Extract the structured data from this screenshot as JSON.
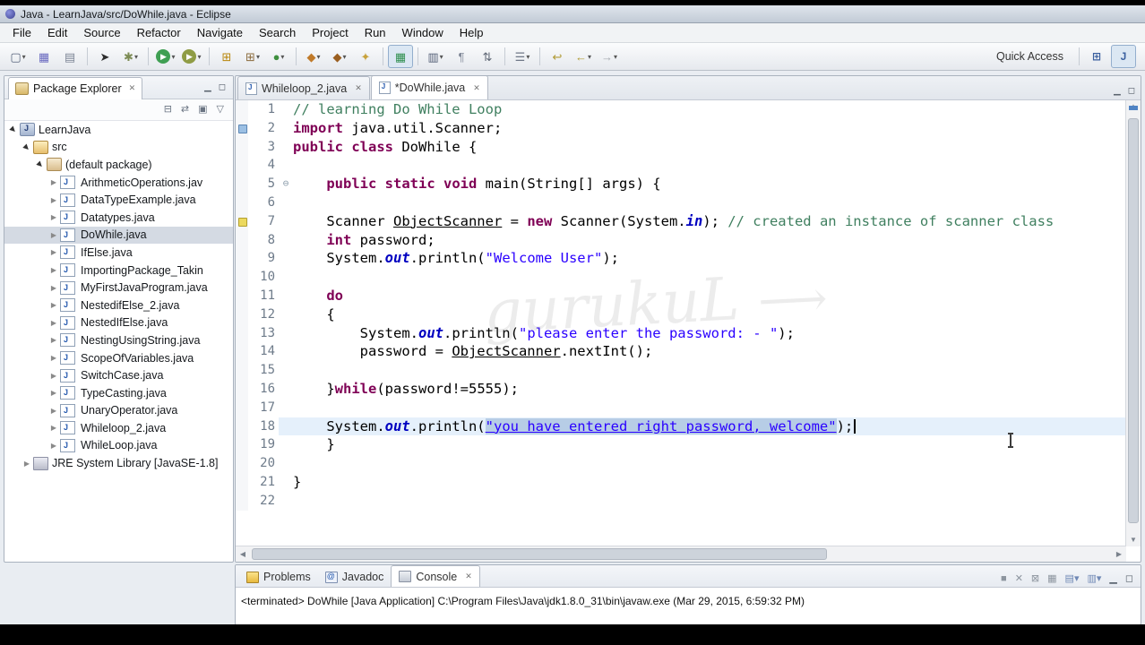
{
  "window": {
    "title": "Java - LearnJava/src/DoWhile.java - Eclipse"
  },
  "menubar": {
    "items": [
      "File",
      "Edit",
      "Source",
      "Refactor",
      "Navigate",
      "Search",
      "Project",
      "Run",
      "Window",
      "Help"
    ]
  },
  "toolbar": {
    "quick_access": "Quick Access",
    "buttons": [
      {
        "name": "new",
        "glyph": "▢",
        "color": "#55617a",
        "dropdown": true
      },
      {
        "name": "save",
        "glyph": "▦",
        "color": "#6a6ac0"
      },
      {
        "name": "print",
        "glyph": "▤",
        "color": "#7d8696"
      },
      {
        "sep": true
      },
      {
        "name": "select-tool",
        "glyph": "➤",
        "color": "#2d2d2d"
      },
      {
        "name": "settings",
        "glyph": "✱",
        "color": "#7c8b54",
        "dropdown": true
      },
      {
        "sep": true
      },
      {
        "name": "run",
        "glyph": "▶",
        "color": "#ffffff",
        "bg": "#3f9f53",
        "dropdown": true
      },
      {
        "name": "coverage",
        "glyph": "▶",
        "color": "#ffffff",
        "bg": "#8f9c45",
        "dropdown": true
      },
      {
        "sep": true
      },
      {
        "name": "new-java-project",
        "glyph": "⊞",
        "color": "#b8860b"
      },
      {
        "name": "new-package",
        "glyph": "⊞",
        "color": "#8b6b3d",
        "dropdown": true
      },
      {
        "name": "new-class",
        "glyph": "●",
        "color": "#3f8f3f",
        "dropdown": true
      },
      {
        "sep": true
      },
      {
        "name": "open-jar",
        "glyph": "◆",
        "color": "#c07a2a",
        "dropdown": true
      },
      {
        "name": "jar-dependencies",
        "glyph": "◆",
        "color": "#9a5f20",
        "dropdown": true
      },
      {
        "name": "search",
        "glyph": "✦",
        "color": "#c8a23c"
      },
      {
        "sep": true
      },
      {
        "name": "capture",
        "glyph": "▦",
        "color": "#2f8f4f",
        "pressed": true
      },
      {
        "sep": true
      },
      {
        "name": "open-console-view",
        "glyph": "▥",
        "color": "#556077",
        "dropdown": true
      },
      {
        "name": "show-whitespace",
        "glyph": "¶",
        "color": "#828a99"
      },
      {
        "name": "sort",
        "glyph": "⇅",
        "color": "#5f6775"
      },
      {
        "sep": true
      },
      {
        "name": "annotations",
        "glyph": "☰",
        "color": "#6f7787",
        "dropdown": true
      },
      {
        "sep": true
      },
      {
        "name": "last-edit-location",
        "glyph": "↩",
        "color": "#b09a34"
      },
      {
        "name": "back",
        "glyph": "←",
        "color": "#b09a34",
        "dropdown": true
      },
      {
        "name": "forward",
        "glyph": "→",
        "color": "#a7abb2",
        "dropdown": true
      }
    ],
    "perspectives": [
      {
        "name": "open-perspective",
        "glyph": "⊞",
        "active": false
      },
      {
        "name": "java-perspective",
        "glyph": "J",
        "active": true
      }
    ]
  },
  "explorer": {
    "title": "Package Explorer",
    "tree": [
      {
        "label": "LearnJava",
        "depth": 0,
        "icon": "project",
        "expander": "expanded"
      },
      {
        "label": "src",
        "depth": 1,
        "icon": "src-folder",
        "expander": "expanded"
      },
      {
        "label": "(default package)",
        "depth": 2,
        "icon": "package",
        "expander": "expanded"
      },
      {
        "label": "ArithmeticOperations.jav",
        "depth": 3,
        "icon": "java-file",
        "expander": "collapsed"
      },
      {
        "label": "DataTypeExample.java",
        "depth": 3,
        "icon": "java-file",
        "expander": "collapsed"
      },
      {
        "label": "Datatypes.java",
        "depth": 3,
        "icon": "java-file",
        "expander": "collapsed"
      },
      {
        "label": "DoWhile.java",
        "depth": 3,
        "icon": "java-file",
        "expander": "collapsed",
        "selected": true
      },
      {
        "label": "IfElse.java",
        "depth": 3,
        "icon": "java-file",
        "expander": "collapsed"
      },
      {
        "label": "ImportingPackage_Takin",
        "depth": 3,
        "icon": "java-file",
        "expander": "collapsed"
      },
      {
        "label": "MyFirstJavaProgram.java",
        "depth": 3,
        "icon": "java-file",
        "expander": "collapsed"
      },
      {
        "label": "NestedifElse_2.java",
        "depth": 3,
        "icon": "java-file",
        "expander": "collapsed"
      },
      {
        "label": "NestedIfElse.java",
        "depth": 3,
        "icon": "java-file",
        "expander": "collapsed"
      },
      {
        "label": "NestingUsingString.java",
        "depth": 3,
        "icon": "java-file",
        "expander": "collapsed"
      },
      {
        "label": "ScopeOfVariables.java",
        "depth": 3,
        "icon": "java-file",
        "expander": "collapsed"
      },
      {
        "label": "SwitchCase.java",
        "depth": 3,
        "icon": "java-file",
        "expander": "collapsed"
      },
      {
        "label": "TypeCasting.java",
        "depth": 3,
        "icon": "java-file",
        "expander": "collapsed"
      },
      {
        "label": "UnaryOperator.java",
        "depth": 3,
        "icon": "java-file",
        "expander": "collapsed"
      },
      {
        "label": "Whileloop_2.java",
        "depth": 3,
        "icon": "java-file",
        "expander": "collapsed"
      },
      {
        "label": "WhileLoop.java",
        "depth": 3,
        "icon": "java-file",
        "expander": "collapsed"
      },
      {
        "label": "JRE System Library [JavaSE-1.8]",
        "depth": 1,
        "icon": "library",
        "expander": "collapsed"
      }
    ]
  },
  "editor": {
    "tabs": [
      {
        "label": "Whileloop_2.java",
        "active": false
      },
      {
        "label": "*DoWhile.java",
        "active": true
      }
    ],
    "code": {
      "current_line": 18,
      "markers": [
        {
          "line": 2,
          "type": "m1"
        },
        {
          "line": 7,
          "type": "m2"
        }
      ],
      "lines": [
        {
          "n": 1,
          "tokens": [
            [
              "c",
              "// learning Do While Loop"
            ]
          ]
        },
        {
          "n": 2,
          "tokens": [
            [
              "k",
              "import"
            ],
            [
              "p",
              " java.util.Scanner;"
            ]
          ]
        },
        {
          "n": 3,
          "tokens": [
            [
              "k",
              "public"
            ],
            [
              "p",
              " "
            ],
            [
              "k",
              "class"
            ],
            [
              "p",
              " DoWhile {"
            ]
          ]
        },
        {
          "n": 4,
          "tokens": []
        },
        {
          "n": 5,
          "fold": true,
          "tokens": [
            [
              "p",
              "    "
            ],
            [
              "k",
              "public"
            ],
            [
              "p",
              " "
            ],
            [
              "k",
              "static"
            ],
            [
              "p",
              " "
            ],
            [
              "k",
              "void"
            ],
            [
              "p",
              " main(String[] args) {"
            ]
          ]
        },
        {
          "n": 6,
          "tokens": []
        },
        {
          "n": 7,
          "tokens": [
            [
              "p",
              "    Scanner "
            ],
            [
              "u",
              "ObjectScanner"
            ],
            [
              "p",
              " = "
            ],
            [
              "k",
              "new"
            ],
            [
              "p",
              " Scanner(System."
            ],
            [
              "f",
              "in"
            ],
            [
              "p",
              "); "
            ],
            [
              "c",
              "// created an instance of scanner class"
            ]
          ]
        },
        {
          "n": 8,
          "tokens": [
            [
              "p",
              "    "
            ],
            [
              "k",
              "int"
            ],
            [
              "p",
              " password;"
            ]
          ]
        },
        {
          "n": 9,
          "tokens": [
            [
              "p",
              "    System."
            ],
            [
              "f",
              "out"
            ],
            [
              "p",
              ".println("
            ],
            [
              "s",
              "\"Welcome User\""
            ],
            [
              "p",
              ");"
            ]
          ]
        },
        {
          "n": 10,
          "tokens": []
        },
        {
          "n": 11,
          "tokens": [
            [
              "p",
              "    "
            ],
            [
              "k",
              "do"
            ]
          ]
        },
        {
          "n": 12,
          "tokens": [
            [
              "p",
              "    {"
            ]
          ]
        },
        {
          "n": 13,
          "tokens": [
            [
              "p",
              "        System."
            ],
            [
              "f",
              "out"
            ],
            [
              "p",
              ".println("
            ],
            [
              "s",
              "\"please enter the password: - \""
            ],
            [
              "p",
              ");"
            ]
          ]
        },
        {
          "n": 14,
          "tokens": [
            [
              "p",
              "        password = "
            ],
            [
              "u",
              "ObjectScanner"
            ],
            [
              "p",
              ".nextInt();"
            ]
          ]
        },
        {
          "n": 15,
          "tokens": []
        },
        {
          "n": 16,
          "tokens": [
            [
              "p",
              "    }"
            ],
            [
              "k",
              "while"
            ],
            [
              "p",
              "(password!=5555);"
            ]
          ]
        },
        {
          "n": 17,
          "tokens": []
        },
        {
          "n": 18,
          "caret": true,
          "tokens": [
            [
              "p",
              "    System."
            ],
            [
              "f",
              "out"
            ],
            [
              "p",
              ".println("
            ],
            [
              "sel",
              "\"you have entered right password, welcome\""
            ],
            [
              "p",
              ");"
            ]
          ]
        },
        {
          "n": 19,
          "tokens": [
            [
              "p",
              "    }"
            ]
          ]
        },
        {
          "n": 20,
          "tokens": []
        },
        {
          "n": 21,
          "tokens": [
            [
              "p",
              "}"
            ]
          ]
        },
        {
          "n": 22,
          "tokens": []
        }
      ]
    }
  },
  "console": {
    "tabs": [
      {
        "label": "Problems",
        "icon": "problems",
        "active": false
      },
      {
        "label": "Javadoc",
        "icon": "javadoc",
        "active": false
      },
      {
        "label": "Console",
        "icon": "console-icon",
        "active": true,
        "closable": true
      }
    ],
    "actions": [
      {
        "name": "terminate",
        "glyph": "■",
        "color": "#8d959f"
      },
      {
        "name": "remove-launch",
        "glyph": "✕",
        "color": "#8d959f"
      },
      {
        "name": "remove-all-terminated",
        "glyph": "⊠",
        "color": "#8d959f"
      },
      {
        "name": "clear-console",
        "glyph": "▦",
        "color": "#8d959f"
      },
      {
        "name": "display-selected-console",
        "glyph": "▤",
        "color": "#6f88b5",
        "dropdown": true
      },
      {
        "name": "open-console",
        "glyph": "▥",
        "color": "#6f88b5",
        "dropdown": true
      },
      {
        "name": "console-minimize",
        "glyph": "▁",
        "color": "#5a636e"
      },
      {
        "name": "console-maximize",
        "glyph": "◻",
        "color": "#5a636e"
      }
    ],
    "text": "<terminated> DoWhile [Java Application] C:\\Program Files\\Java\\jdk1.8.0_31\\bin\\javaw.exe (Mar 29, 2015, 6:59:32 PM)"
  },
  "watermark": {
    "text": "gurukuL",
    "arrow": "⟶"
  }
}
